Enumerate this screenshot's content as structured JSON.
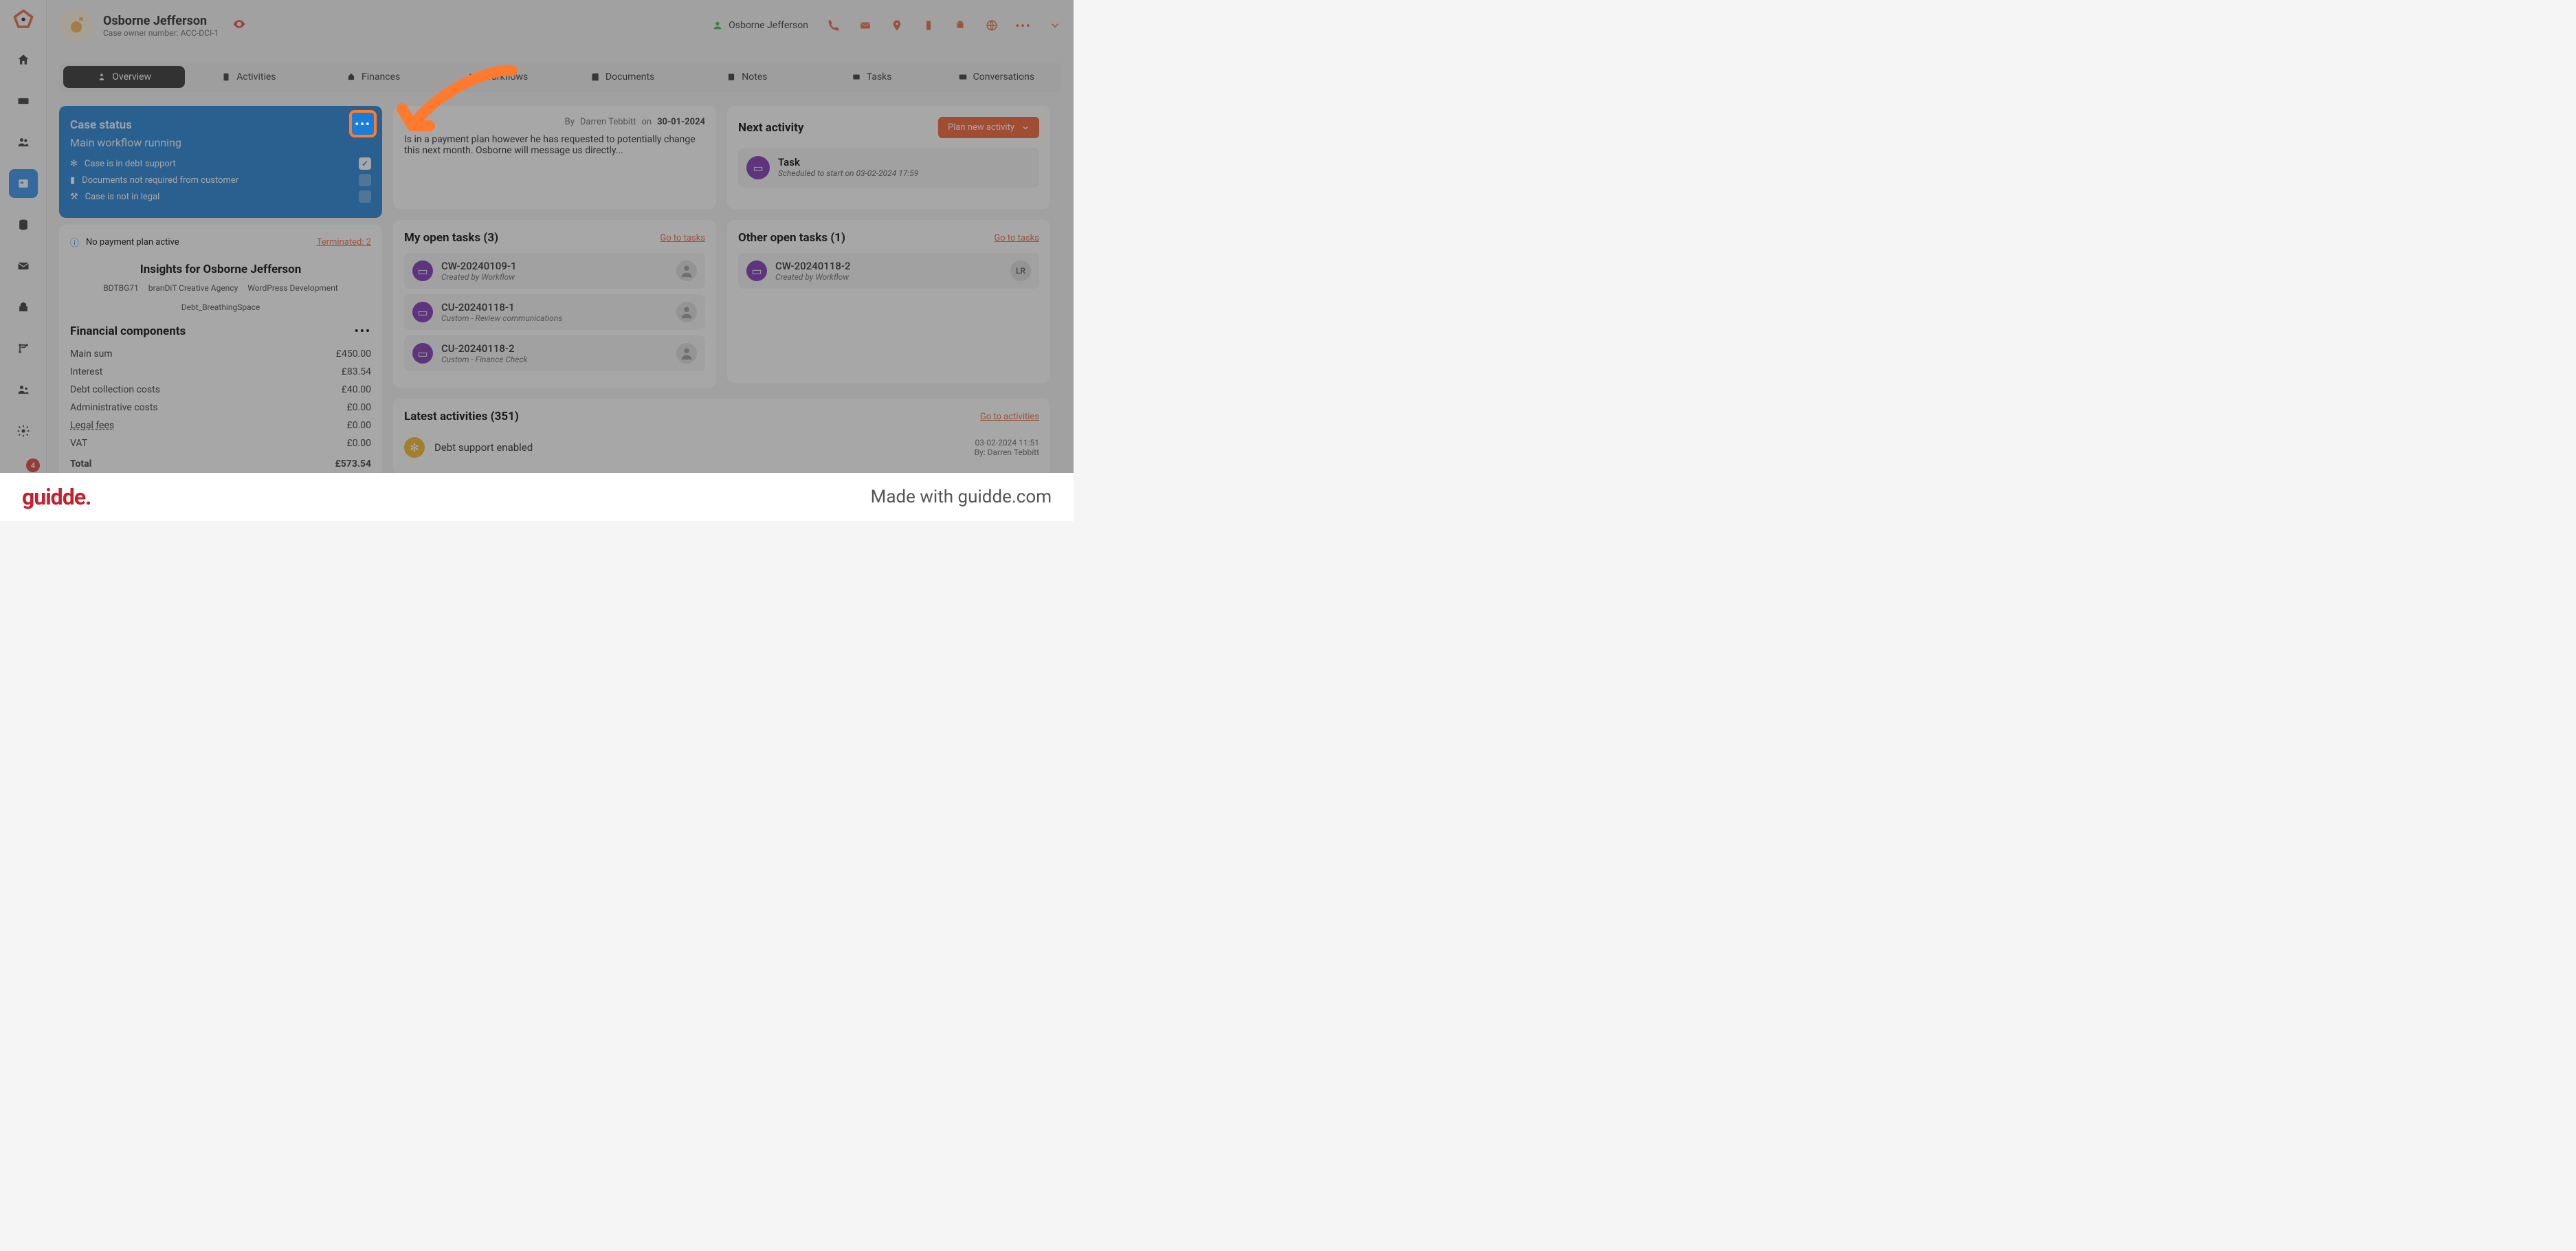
{
  "header": {
    "title": "Osborne Jefferson",
    "subtitle": "Case owner number: ACC-DCI-1",
    "user_name": "Osborne Jefferson"
  },
  "tabs": [
    {
      "label": "Overview",
      "active": true
    },
    {
      "label": "Activities"
    },
    {
      "label": "Finances"
    },
    {
      "label": "Workflows"
    },
    {
      "label": "Documents"
    },
    {
      "label": "Notes"
    },
    {
      "label": "Tasks"
    },
    {
      "label": "Conversations"
    }
  ],
  "case_status": {
    "title": "Case status",
    "subtitle": "Main workflow running",
    "items": [
      {
        "label": "Case is in debt support",
        "checked": true
      },
      {
        "label": "Documents not required from customer",
        "checked": false
      },
      {
        "label": "Case is not in legal",
        "checked": false
      }
    ]
  },
  "banner": {
    "text": "No payment plan active",
    "terminated": "Terminated: 2"
  },
  "insights": {
    "title": "Insights for Osborne Jefferson",
    "tags": [
      "BDTBG71",
      "branDiT Creative Agency",
      "WordPress Development",
      "Debt_BreathingSpace"
    ]
  },
  "financial": {
    "title": "Financial components",
    "rows": [
      {
        "label": "Main sum",
        "value": "£450.00"
      },
      {
        "label": "Interest",
        "value": "£83.54"
      },
      {
        "label": "Debt collection costs",
        "value": "£40.00"
      },
      {
        "label": "Administrative costs",
        "value": "£0.00"
      },
      {
        "label": "Legal fees",
        "value": "£0.00",
        "underline": true
      },
      {
        "label": "VAT",
        "value": "£0.00"
      }
    ],
    "total_label": "Total",
    "total_value": "£573.54"
  },
  "note": {
    "by_prefix": "By ",
    "author": "Darren Tebbitt",
    "on": " on ",
    "date": "30-01-2024",
    "body": "Is in a payment plan however he has requested to potentially change this next month. Osborne will message us directly..."
  },
  "open_tasks": {
    "title": "My open tasks (3)",
    "link": "Go to tasks",
    "items": [
      {
        "title": "CW-20240109-1",
        "sub": "Created by Workflow"
      },
      {
        "title": "CU-20240118-1",
        "sub": "Custom - Review communications"
      },
      {
        "title": "CU-20240118-2",
        "sub": "Custom - Finance Check"
      }
    ]
  },
  "other_tasks": {
    "title": "Other open tasks (1)",
    "link": "Go to tasks",
    "items": [
      {
        "title": "CW-20240118-2",
        "sub": "Created by Workflow",
        "avatar": "LR"
      }
    ]
  },
  "next_activity": {
    "title": "Next activity",
    "button": "Plan new activity",
    "task_title": "Task",
    "task_sub": "Scheduled to start on 03-02-2024 17:59"
  },
  "latest_activities": {
    "title": "Latest activities (351)",
    "link": "Go to activities",
    "items": [
      {
        "text": "Debt support enabled",
        "date": "03-02-2024 11:51",
        "by": "By: Darren Tebbitt"
      }
    ]
  },
  "footer": {
    "logo": "guidde.",
    "made": "Made with guidde.com"
  },
  "notif_count": "4"
}
